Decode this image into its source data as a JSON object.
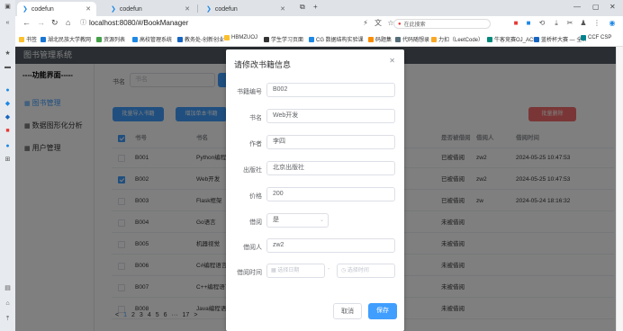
{
  "browser": {
    "tabs": [
      {
        "title": "codefun",
        "active": true
      },
      {
        "title": "codefun",
        "active": false
      },
      {
        "title": "codefun",
        "active": false
      }
    ],
    "url": "localhost:8080/#/BookManager",
    "search_placeholder": "在此搜索",
    "bookmarks": [
      "书签",
      "湖北民族大学教网",
      "资源列表",
      "高校管理系统",
      "教务处-创新创业",
      "HBMZUOJ",
      "学生学习页面",
      "CG 数据结构实验课",
      "码题集",
      "代码随想录",
      "力扣（LeetCode）",
      "牛客竞赛OJ_ACM",
      "蓝桥杯大赛 — 全...",
      "CCF CSP"
    ]
  },
  "app": {
    "header_title": "图书管理系统",
    "sidebar": {
      "title": "----功能界面-----",
      "items": [
        {
          "label": "图书管理",
          "active": true
        },
        {
          "label": "数据图形化分析",
          "active": false
        },
        {
          "label": "用户管理",
          "active": false
        }
      ]
    },
    "filter": {
      "label": "书名",
      "placeholder": "书名"
    },
    "toolbar": {
      "batch_import": "批量导入书籍",
      "add_book": "增加单本书籍",
      "batch_delete": "批量删除"
    },
    "table": {
      "headers": [
        "书号",
        "书名",
        "是否被借阅",
        "借阅人",
        "借阅时间"
      ],
      "rows": [
        {
          "id": "B001",
          "name": "Python编程",
          "status": "已被借阅",
          "borrower": "zw2",
          "time": "2024-05-25 10:47:53",
          "checked": false
        },
        {
          "id": "B002",
          "name": "Web开发",
          "status": "已被借阅",
          "borrower": "zw2",
          "time": "2024-05-25 10:47:53",
          "checked": true
        },
        {
          "id": "B003",
          "name": "Flask框架",
          "status": "已被借阅",
          "borrower": "zw",
          "time": "2024-05-24 18:16:32",
          "checked": false
        },
        {
          "id": "B004",
          "name": "Go语言",
          "status": "未被借阅",
          "borrower": "",
          "time": "",
          "checked": false
        },
        {
          "id": "B005",
          "name": "机器视觉",
          "status": "未被借阅",
          "borrower": "",
          "time": "",
          "checked": false
        },
        {
          "id": "B006",
          "name": "C#编程语言",
          "status": "未被借阅",
          "borrower": "",
          "time": "",
          "checked": false
        },
        {
          "id": "B007",
          "name": "C++编程语言",
          "status": "未被借阅",
          "borrower": "",
          "time": "",
          "checked": false
        },
        {
          "id": "B008",
          "name": "Java编程语言",
          "status": "未被借阅",
          "borrower": "",
          "time": "",
          "checked": false
        }
      ]
    },
    "pager": [
      "<",
      "1",
      "2",
      "3",
      "4",
      "5",
      "6",
      "···",
      "17",
      ">"
    ]
  },
  "dialog": {
    "title": "请修改书籍信息",
    "fields": {
      "id": {
        "label": "书籍编号",
        "value": "B002"
      },
      "name": {
        "label": "书名",
        "value": "Web开发"
      },
      "author": {
        "label": "作者",
        "value": "李四"
      },
      "publisher": {
        "label": "出版社",
        "value": "北京出版社"
      },
      "price": {
        "label": "价格",
        "value": "200"
      },
      "borrowed": {
        "label": "借阅",
        "value": "是"
      },
      "borrower": {
        "label": "借阅人",
        "value": "zw2"
      },
      "borrow_time": {
        "label": "借阅时间",
        "date_placeholder": "选择日期",
        "time_placeholder": "选择时间",
        "separator": "-"
      }
    },
    "cancel_label": "取消",
    "save_label": "保存"
  },
  "colors": {
    "primary": "#409eff",
    "danger": "#f56c6c",
    "header": "#545c64"
  }
}
